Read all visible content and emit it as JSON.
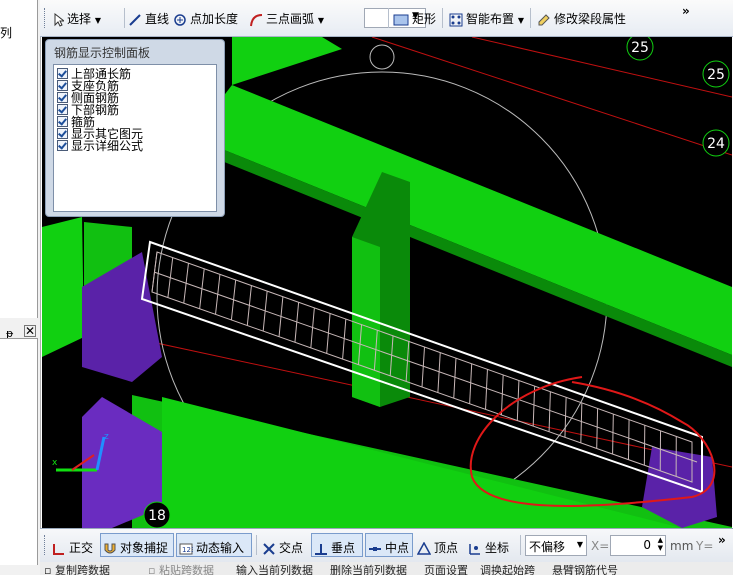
{
  "left_panel": {
    "partial_text": "列",
    "pin_glyph": "ᵽ",
    "close_glyph": "✕"
  },
  "toolbar": {
    "select": "选择",
    "line": "直线",
    "point_length": "点加长度",
    "three_point_arc": "三点画弧",
    "rectangle": "矩形",
    "smart_layout": "智能布置",
    "modify_beam": "修改梁段属性",
    "overflow": "»"
  },
  "panel": {
    "title": "钢筋显示控制面板",
    "options": [
      {
        "label": "上部通长筋",
        "checked": true
      },
      {
        "label": "支座负筋",
        "checked": true
      },
      {
        "label": "侧面钢筋",
        "checked": true
      },
      {
        "label": "下部钢筋",
        "checked": true
      },
      {
        "label": "箍筋",
        "checked": true
      },
      {
        "label": "显示其它图元",
        "checked": true
      },
      {
        "label": "显示详细公式",
        "checked": true
      }
    ]
  },
  "viewport": {
    "axis_labels": [
      "25",
      "25",
      "24",
      "18"
    ],
    "colors": {
      "background": "#000000",
      "column_green": "#11e011",
      "beam_dark_green": "#0a7a0a",
      "purple": "#5a22a8",
      "annotation_red": "#e01818"
    }
  },
  "bottom": {
    "ortho": "正交",
    "snap": "对象捕捉",
    "dynamic_input": "动态输入",
    "intersection": "交点",
    "perpendicular": "垂点",
    "midpoint": "中点",
    "vertex": "顶点",
    "coordinate": "坐标",
    "offset_mode": "不偏移",
    "x_label": "X=",
    "x_value": "0",
    "unit": "mm",
    "y_label": "Y="
  },
  "statusbar": {
    "items": [
      "复制跨数据",
      "粘贴跨数据",
      "输入当前列数据",
      "删除当前列数据",
      "页面设置",
      "调换起始跨",
      "悬臂钢筋代号"
    ]
  }
}
